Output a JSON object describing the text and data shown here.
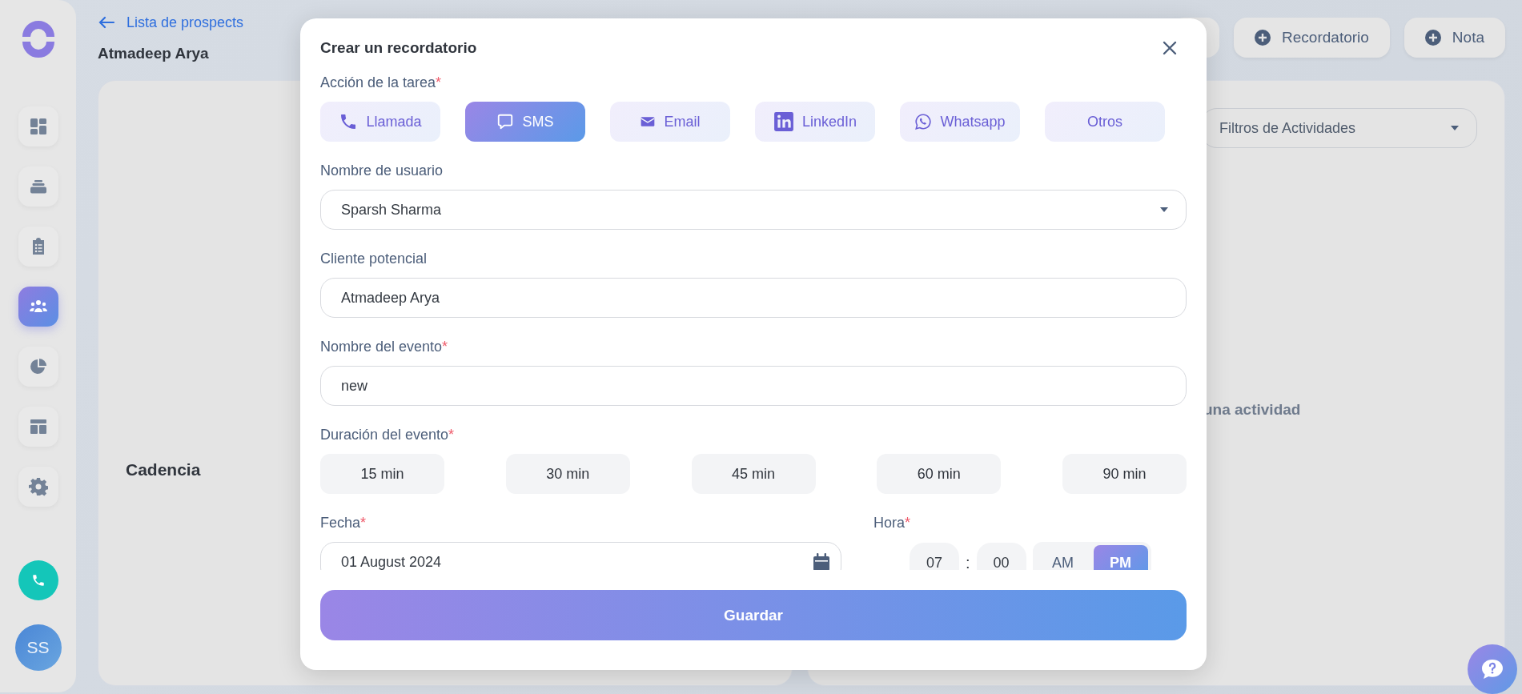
{
  "sidebar": {
    "items": [
      {
        "kind": "dashboard",
        "selected": false
      },
      {
        "kind": "stack",
        "selected": false
      },
      {
        "kind": "clipboard",
        "selected": false
      },
      {
        "kind": "people",
        "selected": true
      },
      {
        "kind": "pie",
        "selected": false
      },
      {
        "kind": "layout",
        "selected": false
      },
      {
        "kind": "gear",
        "selected": false
      }
    ],
    "avatar": "SS"
  },
  "header": {
    "back_link": "Lista de prospects",
    "title": "Atmadeep Arya",
    "buttons": [
      "Recordatorio",
      "Nota"
    ]
  },
  "left_card": {
    "heading": "Cadencia"
  },
  "right_card": {
    "filter": "Filtros de Actividades",
    "empty_text": "una actividad"
  },
  "modal": {
    "title": "Crear un recordatorio",
    "task_action": {
      "label": "Acción de la tarea",
      "required_mark": "*",
      "options": [
        {
          "kind": "phone",
          "label": "Llamada",
          "selected": false
        },
        {
          "kind": "sms",
          "label": "SMS",
          "selected": true
        },
        {
          "kind": "email",
          "label": "Email",
          "selected": false
        },
        {
          "kind": "linkedin",
          "label": "LinkedIn",
          "selected": false
        },
        {
          "kind": "whatsapp",
          "label": "Whatsapp",
          "selected": false
        },
        {
          "kind": "none",
          "label": "Otros",
          "selected": false
        }
      ]
    },
    "user": {
      "label": "Nombre de usuario",
      "value": "Sparsh Sharma"
    },
    "lead": {
      "label": "Cliente potencial",
      "value": "Atmadeep Arya"
    },
    "event_name": {
      "label": "Nombre del evento",
      "required_mark": "*",
      "value": "new"
    },
    "duration": {
      "label": "Duración del evento",
      "required_mark": "*",
      "options": [
        {
          "label": "15 min",
          "selected": false
        },
        {
          "label": "30 min",
          "selected": false
        },
        {
          "label": "45 min",
          "selected": false
        },
        {
          "label": "60 min",
          "selected": false
        },
        {
          "label": "90 min",
          "selected": false
        }
      ]
    },
    "date": {
      "label": "Fecha",
      "required_mark": "*",
      "value": "01 August 2024"
    },
    "time": {
      "label": "Hora",
      "required_mark": "*",
      "hour": "07",
      "separator": ":",
      "minute": "00",
      "periods": [
        {
          "label": "AM",
          "selected": false
        },
        {
          "label": "PM",
          "selected": true
        }
      ]
    },
    "save_button": "Guardar"
  }
}
